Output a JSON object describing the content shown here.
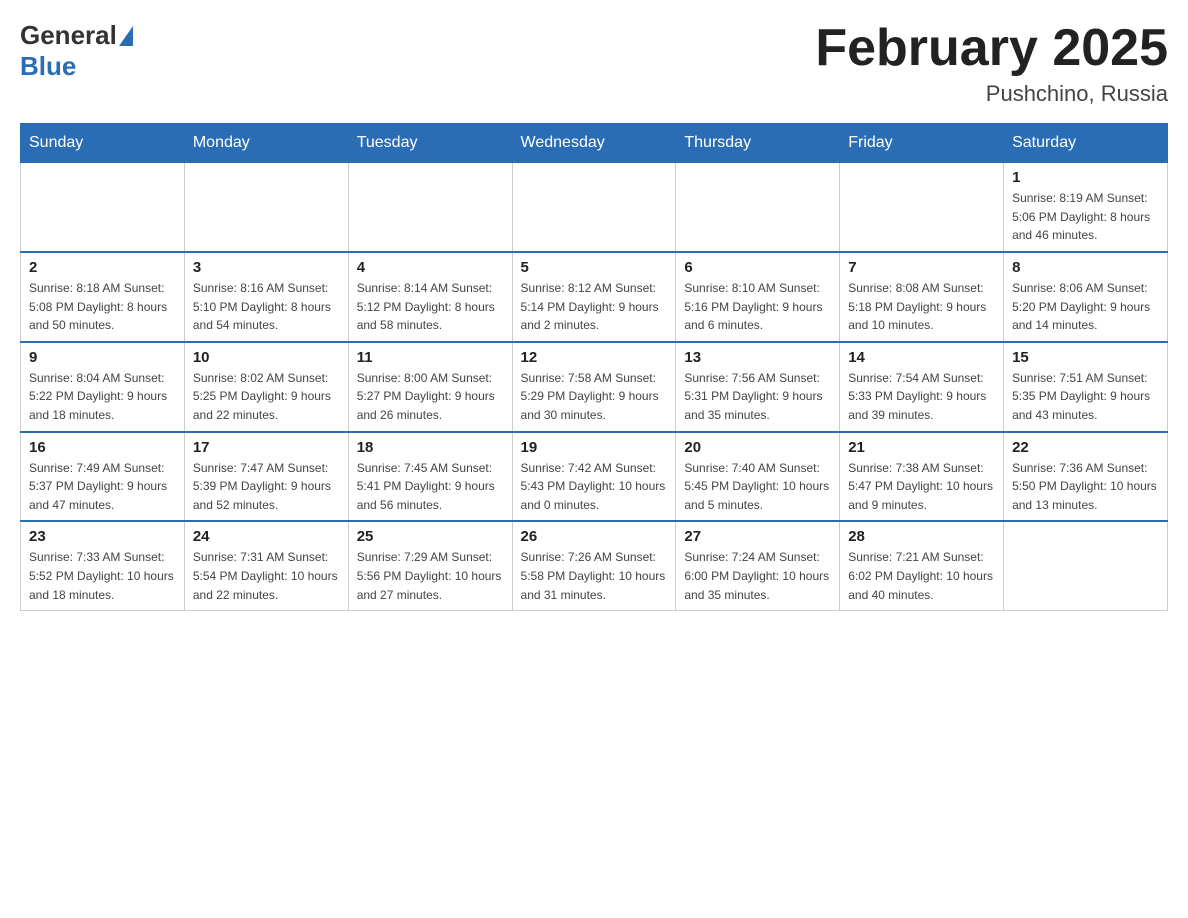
{
  "header": {
    "logo_general": "General",
    "logo_blue": "Blue",
    "month_title": "February 2025",
    "location": "Pushchino, Russia"
  },
  "days_of_week": [
    "Sunday",
    "Monday",
    "Tuesday",
    "Wednesday",
    "Thursday",
    "Friday",
    "Saturday"
  ],
  "weeks": [
    [
      {
        "day": "",
        "info": ""
      },
      {
        "day": "",
        "info": ""
      },
      {
        "day": "",
        "info": ""
      },
      {
        "day": "",
        "info": ""
      },
      {
        "day": "",
        "info": ""
      },
      {
        "day": "",
        "info": ""
      },
      {
        "day": "1",
        "info": "Sunrise: 8:19 AM\nSunset: 5:06 PM\nDaylight: 8 hours\nand 46 minutes."
      }
    ],
    [
      {
        "day": "2",
        "info": "Sunrise: 8:18 AM\nSunset: 5:08 PM\nDaylight: 8 hours\nand 50 minutes."
      },
      {
        "day": "3",
        "info": "Sunrise: 8:16 AM\nSunset: 5:10 PM\nDaylight: 8 hours\nand 54 minutes."
      },
      {
        "day": "4",
        "info": "Sunrise: 8:14 AM\nSunset: 5:12 PM\nDaylight: 8 hours\nand 58 minutes."
      },
      {
        "day": "5",
        "info": "Sunrise: 8:12 AM\nSunset: 5:14 PM\nDaylight: 9 hours\nand 2 minutes."
      },
      {
        "day": "6",
        "info": "Sunrise: 8:10 AM\nSunset: 5:16 PM\nDaylight: 9 hours\nand 6 minutes."
      },
      {
        "day": "7",
        "info": "Sunrise: 8:08 AM\nSunset: 5:18 PM\nDaylight: 9 hours\nand 10 minutes."
      },
      {
        "day": "8",
        "info": "Sunrise: 8:06 AM\nSunset: 5:20 PM\nDaylight: 9 hours\nand 14 minutes."
      }
    ],
    [
      {
        "day": "9",
        "info": "Sunrise: 8:04 AM\nSunset: 5:22 PM\nDaylight: 9 hours\nand 18 minutes."
      },
      {
        "day": "10",
        "info": "Sunrise: 8:02 AM\nSunset: 5:25 PM\nDaylight: 9 hours\nand 22 minutes."
      },
      {
        "day": "11",
        "info": "Sunrise: 8:00 AM\nSunset: 5:27 PM\nDaylight: 9 hours\nand 26 minutes."
      },
      {
        "day": "12",
        "info": "Sunrise: 7:58 AM\nSunset: 5:29 PM\nDaylight: 9 hours\nand 30 minutes."
      },
      {
        "day": "13",
        "info": "Sunrise: 7:56 AM\nSunset: 5:31 PM\nDaylight: 9 hours\nand 35 minutes."
      },
      {
        "day": "14",
        "info": "Sunrise: 7:54 AM\nSunset: 5:33 PM\nDaylight: 9 hours\nand 39 minutes."
      },
      {
        "day": "15",
        "info": "Sunrise: 7:51 AM\nSunset: 5:35 PM\nDaylight: 9 hours\nand 43 minutes."
      }
    ],
    [
      {
        "day": "16",
        "info": "Sunrise: 7:49 AM\nSunset: 5:37 PM\nDaylight: 9 hours\nand 47 minutes."
      },
      {
        "day": "17",
        "info": "Sunrise: 7:47 AM\nSunset: 5:39 PM\nDaylight: 9 hours\nand 52 minutes."
      },
      {
        "day": "18",
        "info": "Sunrise: 7:45 AM\nSunset: 5:41 PM\nDaylight: 9 hours\nand 56 minutes."
      },
      {
        "day": "19",
        "info": "Sunrise: 7:42 AM\nSunset: 5:43 PM\nDaylight: 10 hours\nand 0 minutes."
      },
      {
        "day": "20",
        "info": "Sunrise: 7:40 AM\nSunset: 5:45 PM\nDaylight: 10 hours\nand 5 minutes."
      },
      {
        "day": "21",
        "info": "Sunrise: 7:38 AM\nSunset: 5:47 PM\nDaylight: 10 hours\nand 9 minutes."
      },
      {
        "day": "22",
        "info": "Sunrise: 7:36 AM\nSunset: 5:50 PM\nDaylight: 10 hours\nand 13 minutes."
      }
    ],
    [
      {
        "day": "23",
        "info": "Sunrise: 7:33 AM\nSunset: 5:52 PM\nDaylight: 10 hours\nand 18 minutes."
      },
      {
        "day": "24",
        "info": "Sunrise: 7:31 AM\nSunset: 5:54 PM\nDaylight: 10 hours\nand 22 minutes."
      },
      {
        "day": "25",
        "info": "Sunrise: 7:29 AM\nSunset: 5:56 PM\nDaylight: 10 hours\nand 27 minutes."
      },
      {
        "day": "26",
        "info": "Sunrise: 7:26 AM\nSunset: 5:58 PM\nDaylight: 10 hours\nand 31 minutes."
      },
      {
        "day": "27",
        "info": "Sunrise: 7:24 AM\nSunset: 6:00 PM\nDaylight: 10 hours\nand 35 minutes."
      },
      {
        "day": "28",
        "info": "Sunrise: 7:21 AM\nSunset: 6:02 PM\nDaylight: 10 hours\nand 40 minutes."
      },
      {
        "day": "",
        "info": ""
      }
    ]
  ]
}
